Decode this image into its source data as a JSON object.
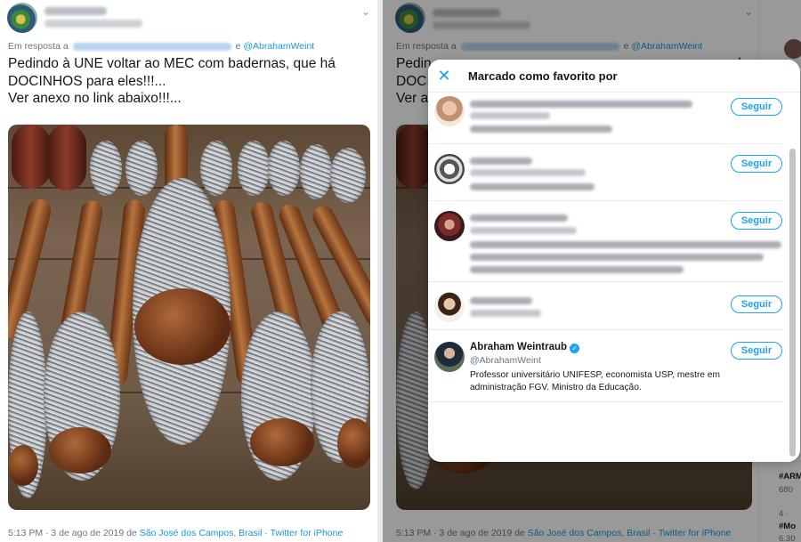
{
  "tweet": {
    "reply_prefix": "Em resposta a",
    "reply_join": "e",
    "reply_handle": "@AbrahamWeint",
    "text_line1": "Pedindo à UNE voltar ao MEC com badernas, que há",
    "text_line2": "DOCINHOS para eles!!!...",
    "text_line3": "Ver anexo no link abaixo!!!...",
    "time": "5:13 PM · 3 de ago de 2019 de",
    "location": "São José dos Campos, Brasil",
    "separator": "·",
    "source": "Twitter for iPhone"
  },
  "right_tweet": {
    "text_line1_visible": "Pedin",
    "text_line1_tail": "d",
    "text_line2_visible": "DOCI",
    "text_line3_visible": "Ver a"
  },
  "modal": {
    "title": "Marcado como favorito por",
    "close_icon": "close-icon",
    "follow_label": "Seguir",
    "named_user": {
      "name": "Abraham Weintraub",
      "handle": "@AbrahamWeint",
      "bio": "Professor universitário UNIFESP, economista USP, mestre em administração FGV. Ministro da Educação.",
      "verified": true
    }
  },
  "sidebar": {
    "trend1": "#ARM",
    "count1": "680",
    "rank2": "4 ·",
    "trend2": "#Mo",
    "count2": "6.30"
  },
  "colors": {
    "accent": "#1da1f2",
    "link": "#1b95e0",
    "muted": "#657786",
    "text": "#14171a"
  }
}
